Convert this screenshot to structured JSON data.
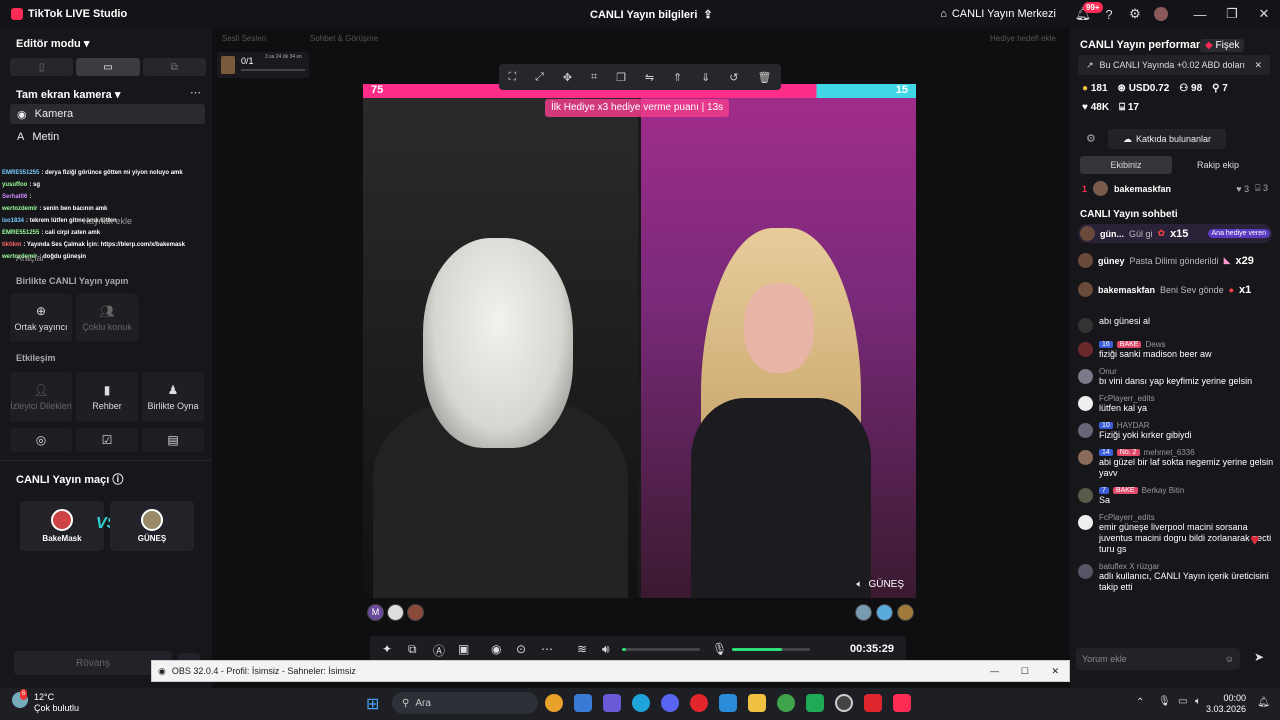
{
  "app": {
    "name": "TikTok LIVE Studio",
    "center_title": "CANLI Yayın bilgileri",
    "live_center": "CANLI Yayın Merkezi",
    "notif_badge": "99+"
  },
  "left": {
    "editor_mode": "Editör modu",
    "camera_section": "Tam ekran kamera",
    "sources": [
      "Kamera",
      "Metin"
    ],
    "overlay_chat": [
      {
        "name": "EMRE551255",
        "text": ": derya fiziği görünce götten mi yiyon noluyo amk",
        "color": "#7cf"
      },
      {
        "name": "yusuffoo",
        "text": ": sg",
        "color": "#9f9"
      },
      {
        "name": "Serhat06",
        "text": ":",
        "color": "#c8f"
      },
      {
        "name": "wertozdemir",
        "text": ": senin ben bacının amk",
        "color": "#9f9"
      },
      {
        "name": "iso1834",
        "text": ": tekrem lütfen gitme amk lütfen",
        "color": "#7cf"
      },
      {
        "name": "EMRE551255",
        "text": ": cali cirpi zaten amk",
        "color": "#9f9"
      },
      {
        "name": "tiktikm",
        "text": ": Yayında Ses Çalmak İçin: https://blerp.com/x/bakemask",
        "color": "#f66"
      },
      {
        "name": "wertozdemir",
        "text": ": doğdu güneşin",
        "color": "#9f9"
      }
    ],
    "overlay_ghost1": "Kaynak ekle",
    "overlay_ghost2": "Araçlar",
    "collab_title": "Birlikte CANLI Yayın yapın",
    "collab_items": [
      "Ortak yayıncı",
      "Çoklu konuk"
    ],
    "interaction_title": "Etkileşim",
    "interaction_items": [
      "İzleyici Dilekleri",
      "Rehber",
      "Birlikte Oyna"
    ],
    "match_title": "CANLI Yayın maçı",
    "fighter_left": "BakeMask",
    "fighter_right": "GÜNEŞ",
    "vs": "VS",
    "rematch": "Rövanş"
  },
  "center": {
    "top_link1": "Sesli Sesleri",
    "top_link2": "Sohbet & Görüşme",
    "top_link3": "Hediye hedefi ekle",
    "goal_count": "0/1",
    "goal_time": "3 sa 24 dk 34 sn",
    "pk_left_score": "75",
    "pk_right_score": "15",
    "gift_banner": "İlk Hediye x3 hediye verme puanı | 13s",
    "guest_name": "GÜNEŞ",
    "timer": "00:35:29",
    "mini_avatar_letter": "M"
  },
  "right": {
    "title": "CANLI Yayın performansı",
    "fisek": "Fişek",
    "notice": "Bu CANLI Yayında +0.02 ABD doları",
    "stats1": [
      "181",
      "USD0.72",
      "98",
      "7"
    ],
    "stats2": [
      "48K",
      "17"
    ],
    "contributors_btn": "Katkıda bulunanlar",
    "tabs": [
      "Ekibiniz",
      "Rakip ekip"
    ],
    "rank": {
      "pos": "1",
      "name": "bakemaskfan",
      "hearts": "3",
      "gifts": "3"
    },
    "chat_title": "CANLI Yayın sohbeti",
    "gifts": [
      {
        "name": "gün...",
        "text": "Gül gi",
        "count": "x15",
        "tag": "Ana hediye veren"
      },
      {
        "name": "güney",
        "text": "Pasta Dilimi gönderildi",
        "count": "x29",
        "tag": ""
      },
      {
        "name": "bakemaskfan",
        "text": "Beni Sev gönde",
        "count": "x1",
        "tag": ""
      }
    ],
    "messages": [
      {
        "name": "",
        "level": "",
        "tag": "",
        "text": "abı günesi al"
      },
      {
        "name": "Dews",
        "level": "16",
        "tag": "BAKE",
        "text": "fiziği sanki madison beer aw"
      },
      {
        "name": "Onur",
        "level": "",
        "tag": "",
        "text": "bı vini dansı yap keyfimiz yerine gelsin"
      },
      {
        "name": "FcPlayerr_edits",
        "level": "",
        "tag": "",
        "text": "lütfen kal ya"
      },
      {
        "name": "HAYDAR",
        "level": "10",
        "tag": "",
        "text": "Fiziği yoki kırker gibiydi"
      },
      {
        "name": "mehmet_6336",
        "level": "14",
        "tag": "No. 2",
        "text": "abi güzel bir laf sokta negemiz yerine gelsin yavv"
      },
      {
        "name": "Berkay Bitin",
        "level": "7",
        "tag": "BAKE",
        "text": "Sa"
      },
      {
        "name": "FcPlayerr_edits",
        "level": "",
        "tag": "",
        "text": "emir güneşe liverpool macini sorsana juventus macini dogru bildi zorlanarak gecti turu gs"
      },
      {
        "name": "batuflex X rüzgar",
        "level": "",
        "tag": "",
        "text": "adlı kullanıcı, CANLI Yayın içerik üreticisini takip etti"
      }
    ],
    "comment_placeholder": "Yorum ekle"
  },
  "obs": {
    "title": "OBS 32.0.4 - Profil: İsimsiz - Sahneler: İsimsiz"
  },
  "taskbar": {
    "temp": "12°C",
    "weather": "Çok bulutlu",
    "search": "Ara",
    "time": "00:00",
    "date": "3.03.2026",
    "weather_badge": "6"
  },
  "colors": {
    "accent": "#fe2c55",
    "pk_red": "#ff2d8a",
    "pk_blue": "#3fd6e6"
  }
}
